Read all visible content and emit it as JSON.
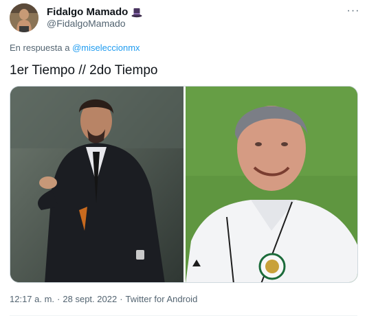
{
  "author": {
    "display_name": "Fidalgo Mamado",
    "handle": "@FidalgoMamado",
    "badge_icon": "top-hat-icon"
  },
  "reply": {
    "prefix": "En respuesta a",
    "mention": "@miseleccionmx"
  },
  "tweet": {
    "text": "1er Tiempo // 2do Tiempo"
  },
  "media": [
    {
      "icon": "photo-man-in-black-suit"
    },
    {
      "icon": "photo-smiling-man-in-white-jacket"
    }
  ],
  "meta": {
    "time": "12:17 a. m.",
    "separator": "·",
    "date": "28 sept. 2022",
    "source": "Twitter for Android"
  },
  "more_button": {
    "label": "···"
  },
  "colors": {
    "accent": "#1d9bf0",
    "secondary_text": "#536471",
    "primary_text": "#0f1419",
    "border": "#cfd9de"
  }
}
